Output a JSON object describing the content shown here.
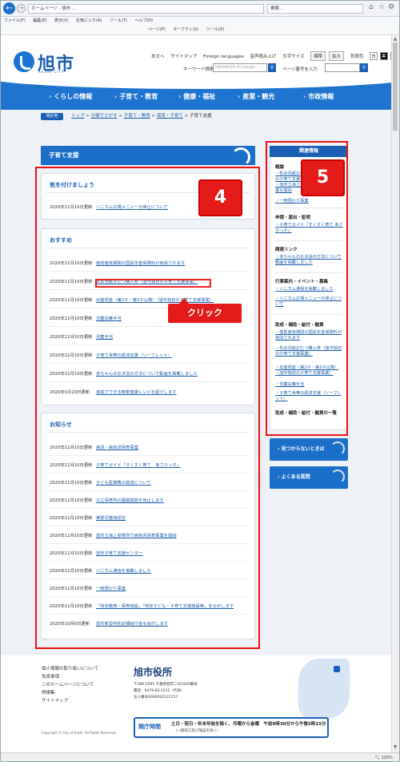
{
  "browser": {
    "address": "ホームページ - 旭市 ...",
    "search_placeholder": "検索...",
    "menu": [
      "ファイル(F)",
      "編集(E)",
      "表示(V)",
      "お気に入り(A)",
      "ツール(T)",
      "ヘルプ(H)"
    ],
    "favbar": [
      "ページ(P)",
      "セーフティ(S)",
      "ツール(O)"
    ],
    "zoom": "100%"
  },
  "header": {
    "logo_text": "旭市",
    "logo_sub": "ASAHI CITY",
    "util_links": [
      "本文へ",
      "サイトマップ",
      "Foreign languages",
      "音声読み上げ"
    ],
    "text_size_label": "文字サイズ",
    "text_size_std": "標準",
    "text_size_large": "拡大",
    "bg_color_label": "背景色",
    "bg_white": "白",
    "bg_black": "黒",
    "bg_blue": "青",
    "keyword_label": "キーワード検索",
    "keyword_placeholder": "ENHANCED BY Google",
    "page_number_label": "ページ番号を入力",
    "search_icon": "magnifier-icon"
  },
  "nav": {
    "items": [
      "くらしの情報",
      "子育て・教育",
      "健康・福祉",
      "産業・観光",
      "市政情報"
    ]
  },
  "breadcrumb": {
    "badge": "現在地",
    "links": [
      "トップ",
      "分類でさがす",
      "子育て・教育",
      "保育・子育て"
    ],
    "current": "子育て支援",
    "sep": ">"
  },
  "main": {
    "title": "子育て支援",
    "cards": [
      {
        "title": "気を付けましょう",
        "rows": [
          {
            "date": "2020年11月10日更新",
            "text": "ハニカム広場メニューの停止について"
          }
        ]
      },
      {
        "title": "おすすめ",
        "rows": [
          {
            "date": "2020年11月10日更新",
            "text": "産前産後期間の国民年金保険料が免除されます"
          },
          {
            "date": "2020年11月10日更新",
            "text": "乳幼児紙おむつ購入券（旭市独自の子育て支援事業）"
          },
          {
            "date": "2020年11月10日更新",
            "text": "出産祝金（第2子・第3子以降）（旭市独自の子育て支援事業）"
          },
          {
            "date": "2020年11月10日更新",
            "text": "児童扶養手当"
          },
          {
            "date": "2020年11月10日更新",
            "text": "児童手当"
          },
          {
            "date": "2020年11月10日更新",
            "text": "子育て世帯の経済支援（リーフレット）"
          },
          {
            "date": "2020年11月10日更新",
            "text": "赤ちゃんのお沐浴の方法について動画を掲載しました"
          },
          {
            "date": "2020年5月29日更新",
            "text": "家庭でできる簡単健康レシピを紹介します"
          }
        ]
      },
      {
        "title": "お知らせ",
        "rows": [
          {
            "date": "2020年11月10日更新",
            "text": "病児・病後児保育事業"
          },
          {
            "date": "2020年11月10日更新",
            "text": "子育てガイド「すくすく育て　あさひっ子」"
          },
          {
            "date": "2020年11月10日更新",
            "text": "子ども医療費の助成について"
          },
          {
            "date": "2020年11月10日更新",
            "text": "公立保育所の園庭開放を休止します"
          },
          {
            "date": "2020年11月10日更新",
            "text": "東部児童館認定"
          },
          {
            "date": "2020年11月10日更新",
            "text": "旭市立海上保育所で病後児保育事業を開始"
          },
          {
            "date": "2020年11月10日更新",
            "text": "旭市子育て支援センター"
          },
          {
            "date": "2020年11月10日更新",
            "text": "ハニカム通信を掲載しました"
          },
          {
            "date": "2020年11月10日更新",
            "text": "一時預かり事業"
          },
          {
            "date": "2020年11月10日更新",
            "text": "「特定教育・保育施設」「特定子ども・子育て支援施設等」を公示します"
          },
          {
            "date": "2020年10月6日更新",
            "text": "旭市新型特別定額給付金を給付します"
          }
        ]
      }
    ],
    "annotation_click": "クリック",
    "annotation_4": "4"
  },
  "sidebar": {
    "head": "関連情報",
    "annotation_5": "5",
    "sections": [
      {
        "title": "概論",
        "links": [
          "乳幼児紙おむつ購入券（旭市独自の子育て支援事業）",
          "旭市立海上保育所で病後児保育事業を開始",
          "一時預かり事業"
        ]
      },
      {
        "title": "申請・届出・証明",
        "links": [
          "子育てガイド「すくすく育て あさひっ子」"
        ]
      },
      {
        "title": "関連リンク",
        "links": [
          "赤ちゃんのお沐浴の方法について動画を掲載しました"
        ]
      },
      {
        "title": "行事案内・イベント・募集",
        "links": [
          "ハニカム通信を掲載しました",
          "ハニカム広場メニューの停止について"
        ]
      },
      {
        "title": "助成・補助・給付・融資",
        "links": [
          "産前産後期間の国民年金保険料が免除されます",
          "乳幼児紙おむつ購入券（旭市独自の子育て支援事業）",
          "出産祝金（第2子・第3子以降）（旭市独自の子育て支援事業）",
          "児童扶養手当",
          "子育て世帯の経済支援（リーフレット）"
        ]
      }
    ],
    "more": "助成・補助・給付・融資の一覧",
    "btn_notfound": "見つからないときは",
    "btn_faq": "よくある質問"
  },
  "footer": {
    "links": [
      "個人情報の取り扱いについて",
      "免責事項",
      "このホームページについて",
      "例規集",
      "サイトマップ"
    ],
    "copyright": "Copyright © City of Asahi. All Rights Reserved.",
    "office": "旭市役所",
    "address": "〒289-2595 千葉県旭市二の1920番地",
    "tel": "電話：0479-62-1212（代表）",
    "corp": "法人番号6000020122157",
    "hours_label": "開庁時間",
    "hours_text": "土日・祝日・年末年始を除く、月曜から金曜　午前8時30分から午後5時15分",
    "hours_note": "（一部窓口及び施設を除く）"
  },
  "colors": {
    "accent": "#1b6fc9",
    "annotation": "#e51b1b",
    "link": "#1d5fa8"
  }
}
